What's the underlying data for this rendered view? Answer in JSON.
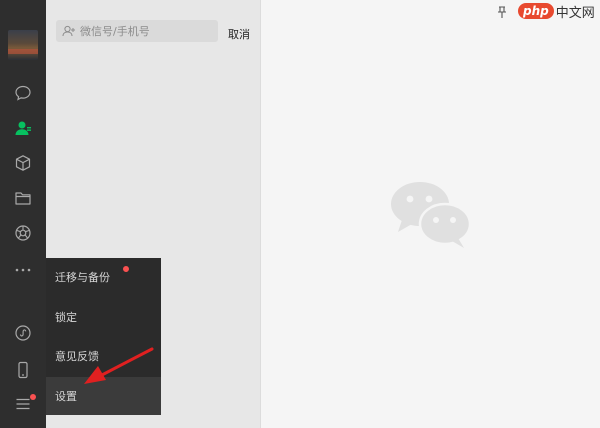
{
  "sidebar": {
    "avatar_label": "avatar",
    "icons": [
      "chat-icon",
      "contacts-icon",
      "box-icon",
      "folder-icon",
      "aperture-icon",
      "more-icon",
      "miniprogram-icon",
      "phone-icon",
      "menu-icon"
    ]
  },
  "search": {
    "placeholder": "微信号/手机号",
    "cancel_label": "取消"
  },
  "watermark": {
    "logo": "php",
    "text": "中文网"
  },
  "popup_menu": {
    "items": [
      {
        "label": "迁移与备份",
        "badge": true
      },
      {
        "label": "锁定"
      },
      {
        "label": "意见反馈"
      },
      {
        "label": "设置",
        "active": true
      }
    ]
  },
  "colors": {
    "sidebar": "#2e2e2e",
    "active_green": "#07c160",
    "badge_red": "#fa5151",
    "arrow_red": "#e02020"
  }
}
